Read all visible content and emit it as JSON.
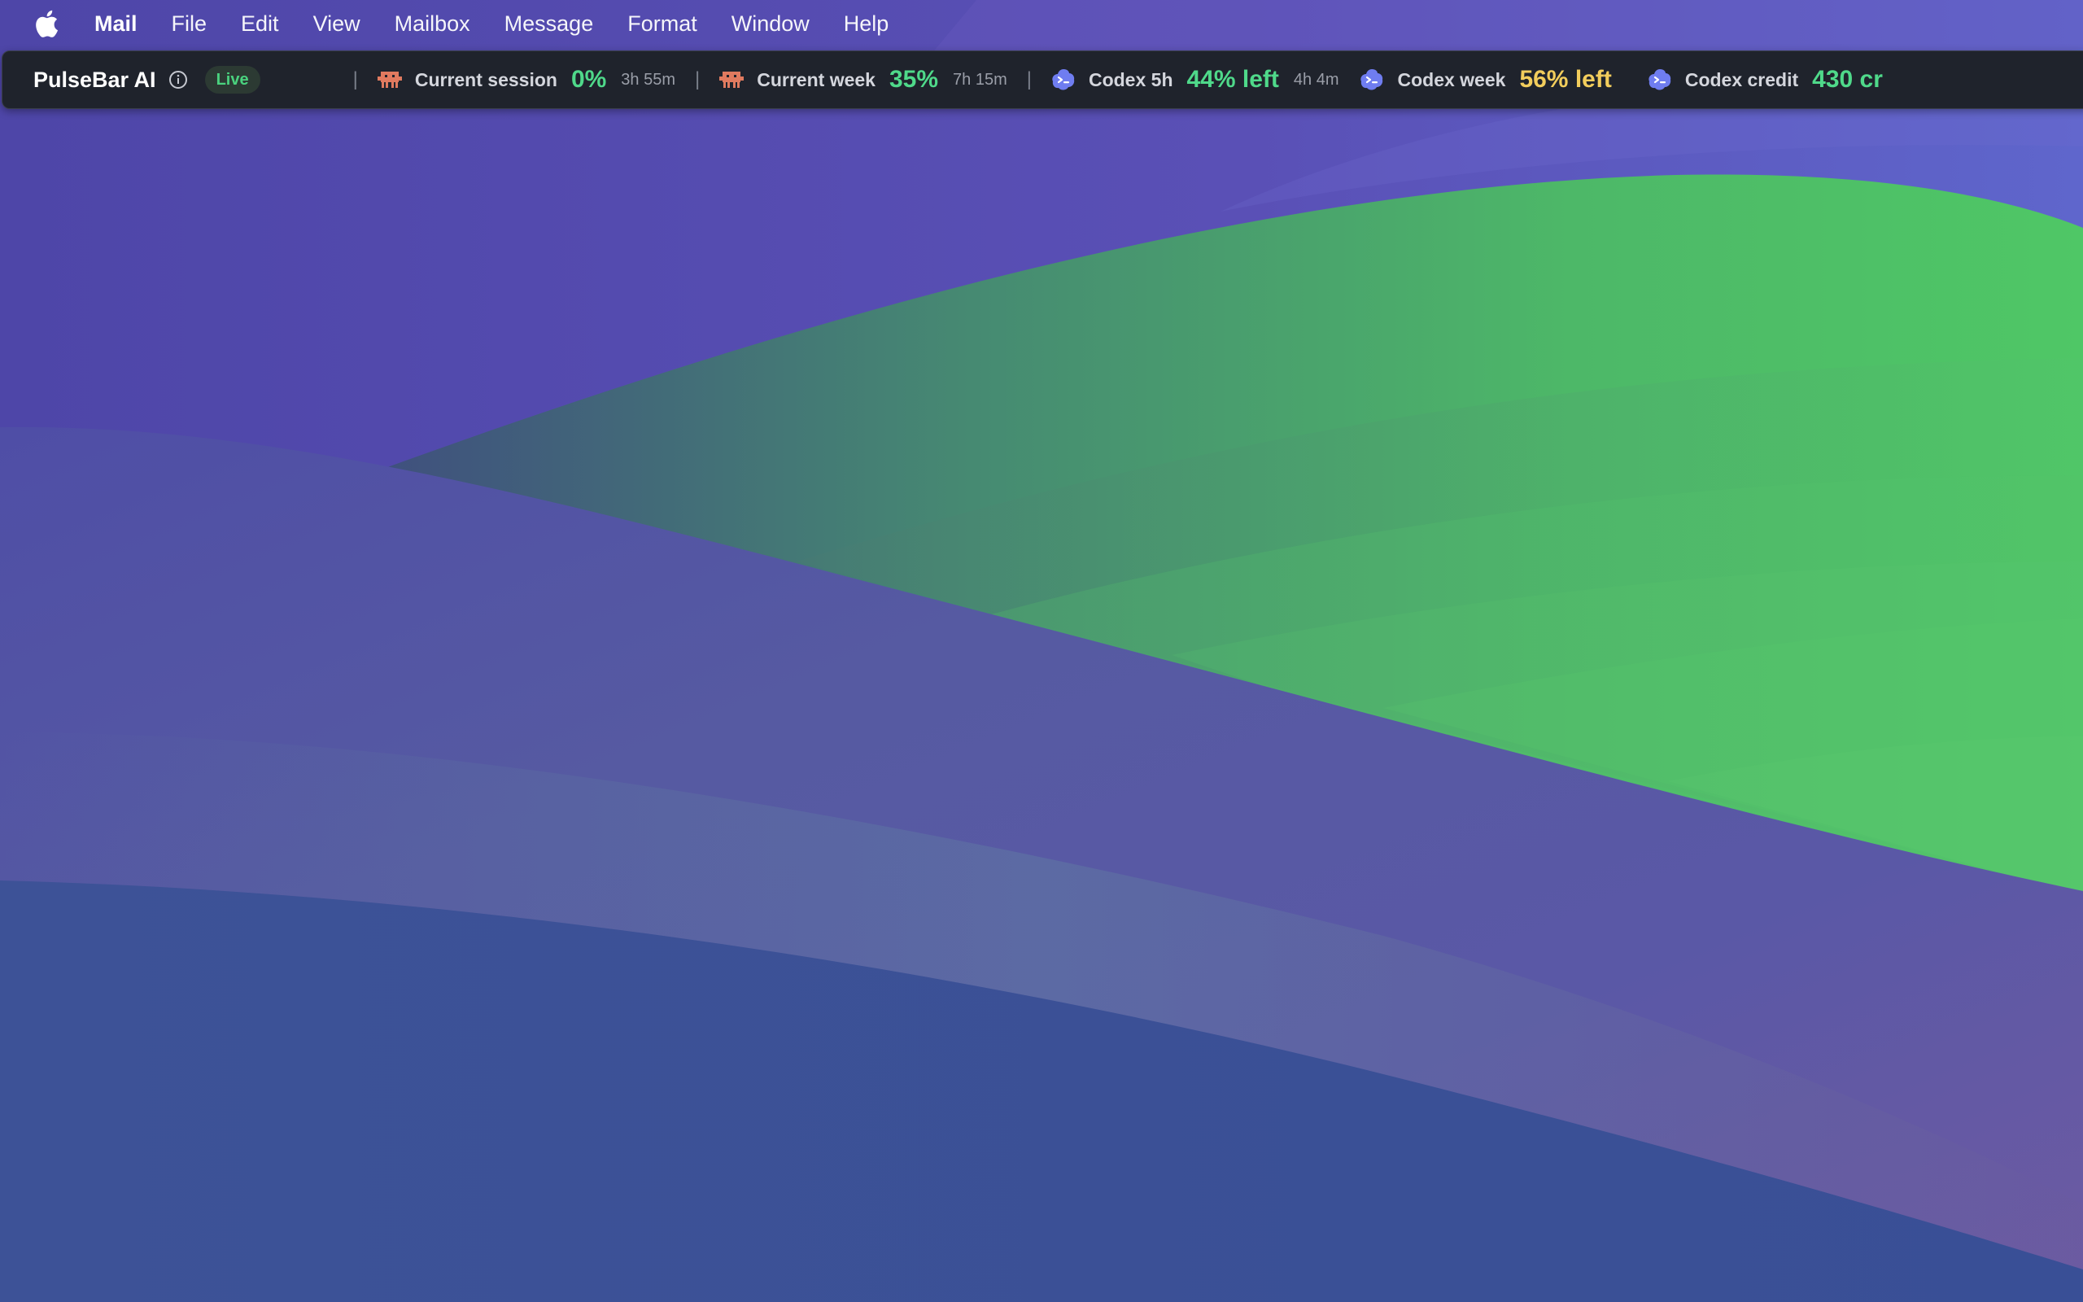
{
  "menubar": {
    "apple_icon": "apple-logo-icon",
    "app_name": "Mail",
    "items": [
      "File",
      "Edit",
      "View",
      "Mailbox",
      "Message",
      "Format",
      "Window",
      "Help"
    ]
  },
  "pulsebar": {
    "brand": "PulseBar AI",
    "info_icon": "info-circle-icon",
    "status_badge": "Live",
    "separator": "|",
    "metrics": [
      {
        "icon": "claude-pixel-icon",
        "label": "Current session",
        "value": "0%",
        "time": "3h 55m",
        "value_color": "#4fd98a"
      },
      {
        "icon": "claude-pixel-icon",
        "label": "Current week",
        "value": "35%",
        "time": "7h 15m",
        "value_color": "#4fd98a"
      },
      {
        "icon": "codex-cloud-icon",
        "label": "Codex 5h",
        "value": "44% left",
        "time": "4h 4m",
        "value_color": "#4fd98a"
      },
      {
        "icon": "codex-cloud-icon",
        "label": "Codex week",
        "value": "56% left",
        "value_color": "#f2cd5c"
      },
      {
        "icon": "codex-cloud-icon",
        "label": "Codex credit",
        "value": "430 cr",
        "value_color": "#4fd98a"
      }
    ]
  },
  "colors": {
    "claude_icon": "#e07a5f",
    "codex_icon": "#6f7df0",
    "green_value": "#4fd98a",
    "yellow_value": "#f2cd5c",
    "wallpaper_green": "#4cc466",
    "wallpaper_purple": "#5a4cb4"
  }
}
